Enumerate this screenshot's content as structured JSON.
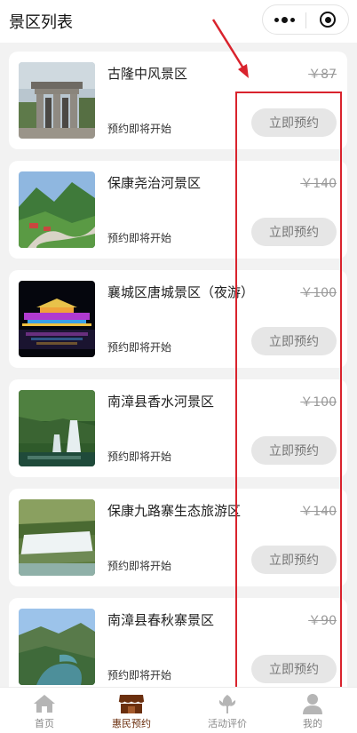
{
  "header": {
    "title": "景区列表"
  },
  "spots": [
    {
      "name": "古隆中风景区",
      "price": "￥87",
      "status": "预约即将开始",
      "button": "立即预约",
      "image": "memorial-archway"
    },
    {
      "name": "保康尧治河景区",
      "price": "￥140",
      "status": "预约即将开始",
      "button": "立即预约",
      "image": "mountain-valley"
    },
    {
      "name": "襄城区唐城景区（夜游）",
      "price": "￥100",
      "status": "预约即将开始",
      "button": "立即预约",
      "image": "night-palace"
    },
    {
      "name": "南漳县香水河景区",
      "price": "￥100",
      "status": "预约即将开始",
      "button": "立即预约",
      "image": "forest-waterfall"
    },
    {
      "name": "保康九路寨生态旅游区",
      "price": "￥140",
      "status": "预约即将开始",
      "button": "立即预约",
      "image": "cascade-waterfall"
    },
    {
      "name": "南漳县春秋寨景区",
      "price": "￥90",
      "status": "预约即将开始",
      "button": "立即预约",
      "image": "river-gorge"
    }
  ],
  "tabbar": {
    "active": "惠民预约",
    "items": [
      {
        "label": "首页",
        "icon": "home-icon"
      },
      {
        "label": "惠民预约",
        "icon": "shop-icon"
      },
      {
        "label": "活动评价",
        "icon": "flower-icon"
      },
      {
        "label": "我的",
        "icon": "user-icon"
      }
    ]
  },
  "colors": {
    "annotation": "#d9232d",
    "active_tab": "#6b2f0e",
    "button_bg": "#e6e6e6"
  }
}
